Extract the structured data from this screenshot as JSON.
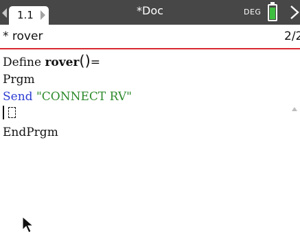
{
  "topbar": {
    "active_tab": "1.1",
    "doc_title": "*Doc",
    "angle_mode": "DEG",
    "battery_color": "#3fbf3f"
  },
  "header": {
    "program_name": "* rover",
    "page_indicator": "2/2"
  },
  "editor": {
    "line1": {
      "prefix": "Define ",
      "name": "rover",
      "parens": "()",
      "suffix": "="
    },
    "line2": "Prgm",
    "line3": {
      "keyword": "Send",
      "string": "\"CONNECT RV\""
    },
    "line5": "EndPrgm"
  },
  "colors": {
    "title_bar": "#474747",
    "header_underline": "#d8252f",
    "keyword": "#2b3bd1",
    "string": "#2c8a2c"
  },
  "icons": {
    "tab_left": "triangle-left-icon",
    "tab_right": "triangle-right-icon",
    "next_page": "chevron-right-icon",
    "battery": "battery-icon",
    "pointer": "mouse-pointer-icon"
  }
}
